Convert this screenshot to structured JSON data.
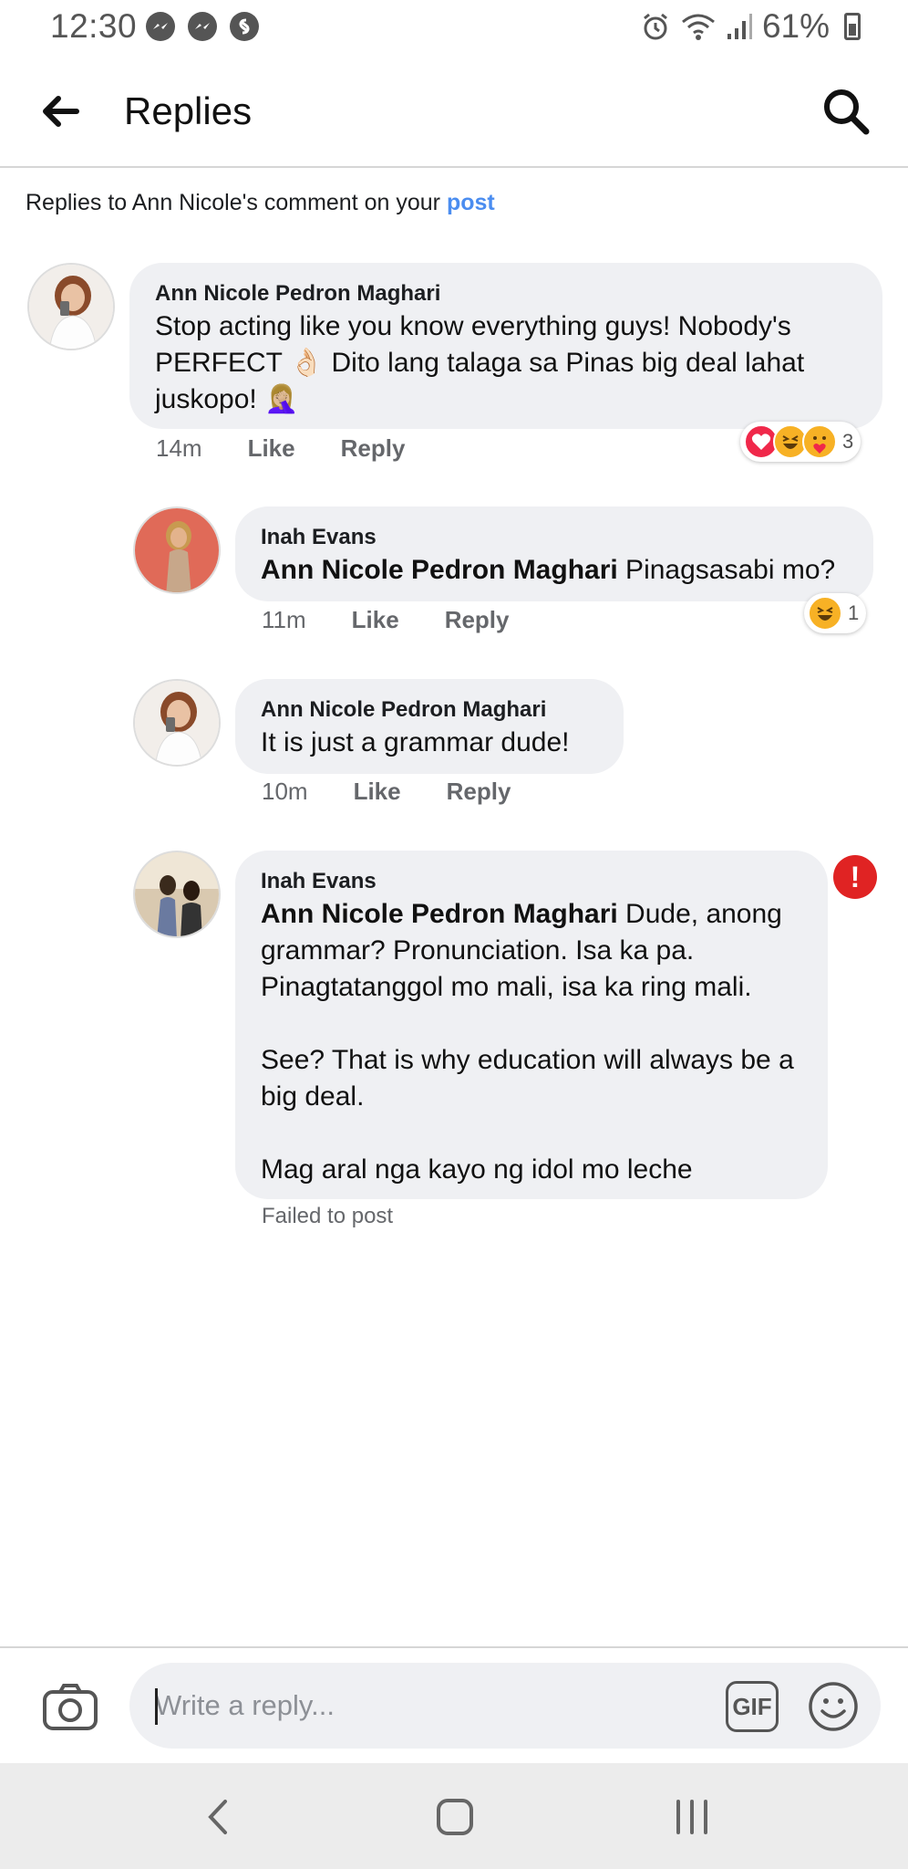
{
  "status": {
    "time": "12:30",
    "battery": "61%",
    "left_icons": [
      "messenger-icon",
      "messenger-icon",
      "shazam-icon"
    ],
    "right_icons": [
      "alarm-icon",
      "wifi-icon",
      "signal-icon",
      "battery-icon"
    ]
  },
  "header": {
    "title": "Replies"
  },
  "subheader": {
    "prefix": "Replies to Ann Nicole's comment on your ",
    "link": "post"
  },
  "comments": [
    {
      "author": "Ann Nicole Pedron Maghari",
      "text": "Stop acting like you know everything guys! Nobody's PERFECT 👌🏻 Dito lang talaga sa Pinas big deal lahat juskopo! 🤦🏼‍♀️",
      "time": "14m",
      "like": "Like",
      "reply": "Reply",
      "reaction_count": "3",
      "reaction_icons": [
        "love-icon",
        "haha-icon",
        "care-icon"
      ]
    },
    {
      "author": "Inah Evans",
      "mention": "Ann Nicole Pedron Maghari",
      "text": " Pinagsasabi mo?",
      "time": "11m",
      "like": "Like",
      "reply": "Reply",
      "reaction_count": "1",
      "reaction_icons": [
        "haha-icon"
      ]
    },
    {
      "author": "Ann Nicole Pedron Maghari",
      "text": "It is just a grammar dude!",
      "time": "10m",
      "like": "Like",
      "reply": "Reply"
    },
    {
      "author": "Inah Evans",
      "mention": "Ann Nicole Pedron Maghari",
      "text": " Dude, anong grammar? Pronunciation. Isa ka pa. Pinagtatanggol mo mali, isa ka ring mali.\n\nSee? That is why education will always be a big deal.\n\nMag aral nga kayo ng idol mo leche",
      "status": "Failed to post"
    }
  ],
  "composer": {
    "placeholder": "Write a reply...",
    "gif_label": "GIF"
  },
  "colors": {
    "link": "#4b8df0",
    "bubble": "#eff0f3",
    "error": "#e02323",
    "muted": "#65676b"
  }
}
